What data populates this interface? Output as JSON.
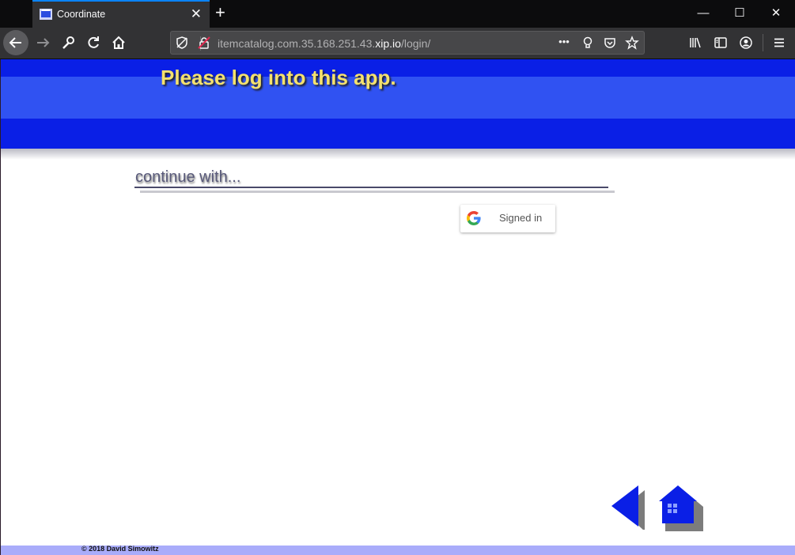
{
  "browser": {
    "tab_title": "Coordinate",
    "tab_close": "✕",
    "new_tab": "+",
    "window_controls": {
      "minimize": "—",
      "maximize": "☐",
      "close": "✕"
    },
    "url": {
      "prefix": "itemcatalog.com.35.168.251.43.",
      "domain": "xip.io",
      "path": "/login/"
    },
    "page_actions": "•••",
    "icons": {
      "back": "arrow-left-icon",
      "forward": "arrow-right-icon",
      "tools": "wrench-icon",
      "reload": "reload-icon",
      "home": "home-icon",
      "tracking": "tracking-protection-icon",
      "insecure": "insecure-lock-icon",
      "lightbulb": "lightbulb-icon",
      "pocket": "pocket-icon",
      "bookmark": "star-icon",
      "library": "library-icon",
      "sidebar": "sidebar-icon",
      "account": "account-icon",
      "menu": "hamburger-menu-icon"
    }
  },
  "page": {
    "header_title": "Please log into this app.",
    "continue_text": "continue with...",
    "google_button_label": "Signed in",
    "footer_text": "© 2018 David Simowitz"
  },
  "colors": {
    "header_blue": "#0a1fe6",
    "header_band": "#3052f2",
    "title_yellow": "#f4e16e",
    "footer_bar": "#a9acfa",
    "nav_blue": "#0a1fe6"
  }
}
